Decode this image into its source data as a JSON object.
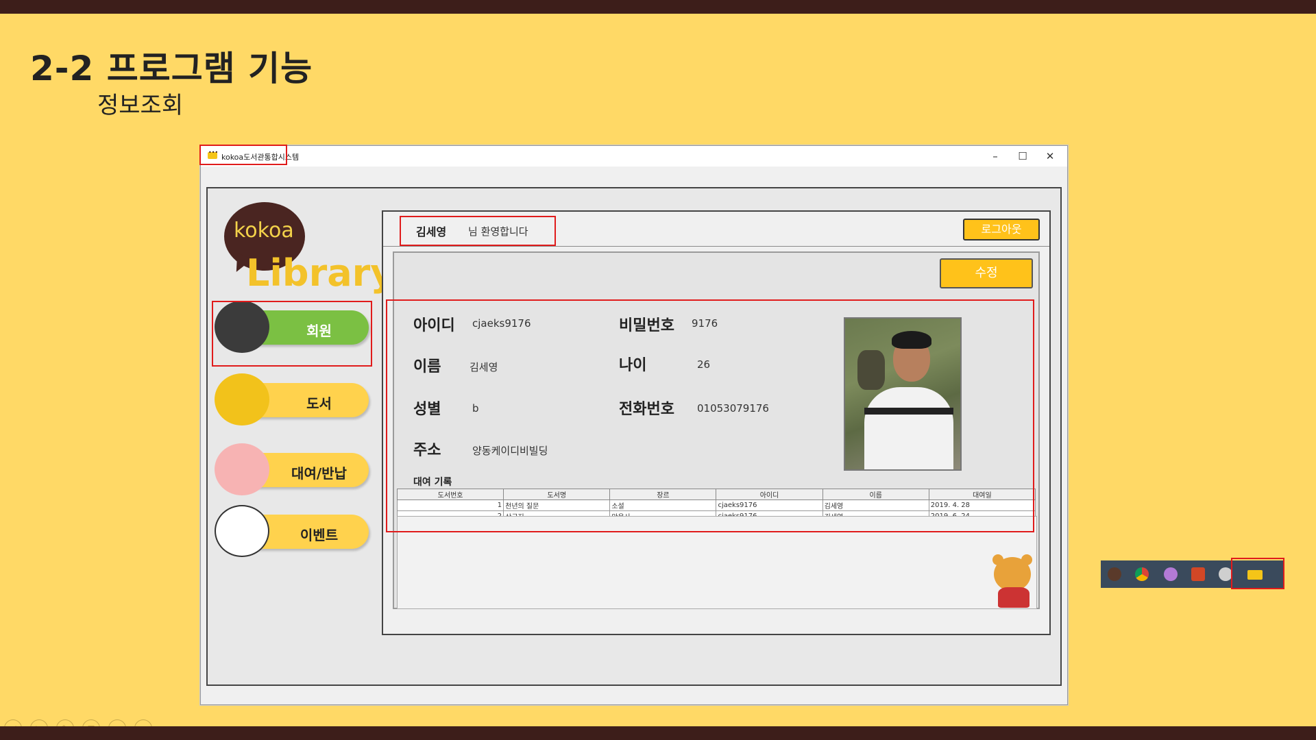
{
  "slide": {
    "title": "2-2 프로그램 기능",
    "subtitle": "정보조회"
  },
  "window": {
    "title": "kokoa도서관통합시스템",
    "min_glyph": "–",
    "max_glyph": "☐",
    "close_glyph": "✕"
  },
  "logo": {
    "bubble_text": "kokoa",
    "library_text": "Library"
  },
  "menu": {
    "items": [
      {
        "label": "회원",
        "active": true
      },
      {
        "label": "도서",
        "active": false
      },
      {
        "label": "대여/반납",
        "active": false
      },
      {
        "label": "이벤트",
        "active": false
      }
    ]
  },
  "header": {
    "user_name": "김세영",
    "welcome_text": "님 환영합니다",
    "logout_label": "로그아웃"
  },
  "profile": {
    "edit_label": "수정",
    "fields": {
      "id_label": "아이디",
      "id_value": "cjaeks9176",
      "password_label": "비밀번호",
      "password_value": "9176",
      "name_label": "이름",
      "name_value": "김세영",
      "age_label": "나이",
      "age_value": "26",
      "gender_label": "성별",
      "gender_value": "b",
      "phone_label": "전화번호",
      "phone_value": "01053079176",
      "address_label": "주소",
      "address_value": "양동케이디비빌딩"
    }
  },
  "rental": {
    "title": "대여 기록",
    "columns": [
      "도서번호",
      "도서명",
      "장르",
      "아이디",
      "이름",
      "대여일"
    ],
    "rows": [
      [
        "1",
        "천년의 질문",
        "소설",
        "cjaeks9176",
        "김세영",
        "2019. 4. 28"
      ],
      [
        "2",
        "삼국지",
        "만음사",
        "cjaeks9176",
        "김세영",
        "2019. 6. 24"
      ]
    ]
  },
  "colors": {
    "slide_bg": "#FFD966",
    "bar_dark": "#3d1e1a",
    "highlight_red": "#e01b1b",
    "button_yellow": "#ffc21a",
    "active_green": "#7bc043"
  }
}
